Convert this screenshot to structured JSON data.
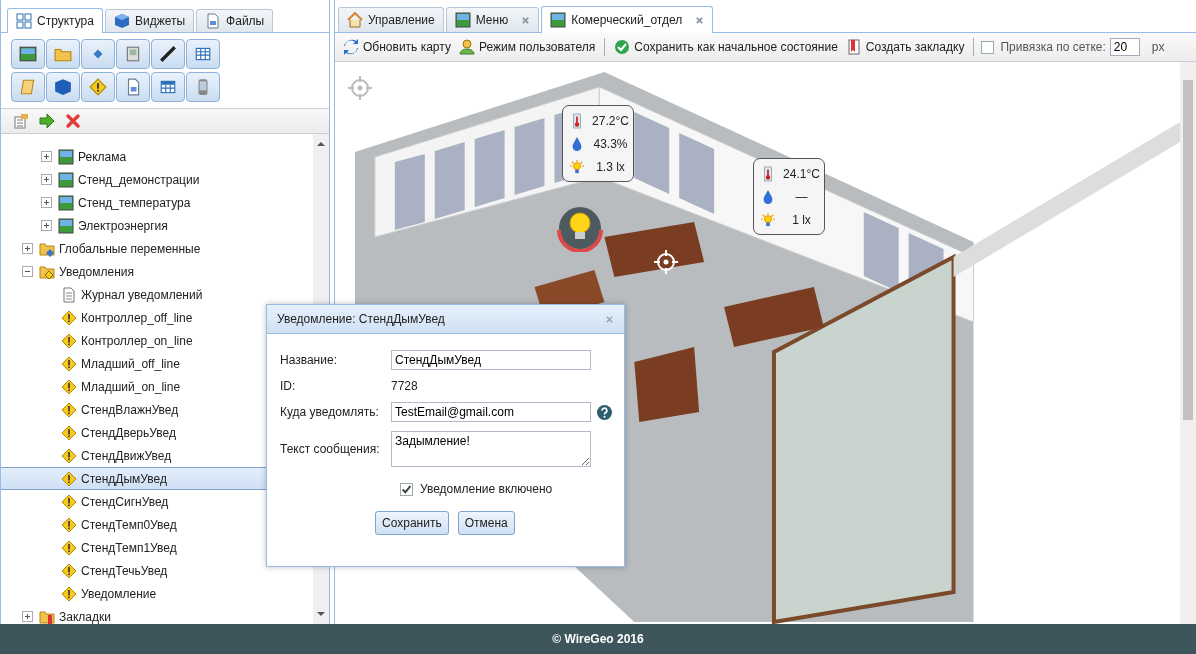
{
  "left_panel": {
    "tabs": [
      {
        "label": "Структура",
        "selected": true
      },
      {
        "label": "Виджеты",
        "selected": false
      },
      {
        "label": "Файлы",
        "selected": false
      }
    ]
  },
  "tree": {
    "scrolled_children": [
      {
        "label": "Реклама",
        "kind": "map",
        "expanded": false
      },
      {
        "label": "Стенд_демонстрации",
        "kind": "map",
        "expanded": false
      },
      {
        "label": "Стенд_температура",
        "kind": "map",
        "expanded": false
      },
      {
        "label": "Электроэнергия",
        "kind": "map",
        "expanded": false
      }
    ],
    "nodes": [
      {
        "label": "Глобальные переменные",
        "kind": "folder-var",
        "expanded": false,
        "selected": false
      },
      {
        "label": "Уведомления",
        "kind": "folder-alert",
        "expanded": true,
        "selected": false,
        "children": [
          {
            "label": "Журнал уведомлений",
            "kind": "log",
            "selected": false
          },
          {
            "label": "Контроллер_off_line",
            "kind": "alert",
            "selected": false
          },
          {
            "label": "Контроллер_on_line",
            "kind": "alert",
            "selected": false
          },
          {
            "label": "Младший_off_line",
            "kind": "alert",
            "selected": false
          },
          {
            "label": "Младший_on_line",
            "kind": "alert",
            "selected": false
          },
          {
            "label": "СтендВлажнУвед",
            "kind": "alert",
            "selected": false
          },
          {
            "label": "СтендДверьУвед",
            "kind": "alert",
            "selected": false
          },
          {
            "label": "СтендДвижУвед",
            "kind": "alert",
            "selected": false
          },
          {
            "label": "СтендДымУвед",
            "kind": "alert",
            "selected": true
          },
          {
            "label": "СтендСигнУвед",
            "kind": "alert",
            "selected": false
          },
          {
            "label": "СтендТемп0Увед",
            "kind": "alert",
            "selected": false
          },
          {
            "label": "СтендТемп1Увед",
            "kind": "alert",
            "selected": false
          },
          {
            "label": "СтендТечьУвед",
            "kind": "alert",
            "selected": false
          },
          {
            "label": "Уведомление",
            "kind": "alert",
            "selected": false
          }
        ]
      },
      {
        "label": "Закладки",
        "kind": "bookmarks",
        "expanded": false,
        "selected": false
      }
    ]
  },
  "editor": {
    "tabs": [
      {
        "label": "Управление",
        "closable": false,
        "selected": false
      },
      {
        "label": "Меню",
        "closable": true,
        "selected": false
      },
      {
        "label": "Комерческий_отдел",
        "closable": true,
        "selected": true
      }
    ],
    "toolbar": [
      {
        "label": "Обновить карту"
      },
      {
        "label": "Режим пользователя"
      },
      {
        "label": "Сохранить как начальное состояние"
      },
      {
        "label": "Создать закладку"
      }
    ],
    "grid_snap": {
      "label": "Привязка по сетке:",
      "checked": false,
      "value": "20",
      "unit": "px"
    }
  },
  "sensors": [
    {
      "rows": [
        {
          "kind": "temperature",
          "value": "27.2°C"
        },
        {
          "kind": "humidity",
          "value": "43.3%"
        },
        {
          "kind": "light",
          "value": "1.3 lx"
        }
      ]
    },
    {
      "rows": [
        {
          "kind": "temperature",
          "value": "24.1°C"
        },
        {
          "kind": "humidity",
          "value": "—"
        },
        {
          "kind": "light",
          "value": "1 lx"
        }
      ]
    }
  ],
  "dialog": {
    "title": "Уведомление: СтендДымУвед",
    "fields": [
      {
        "kind": "input",
        "label": "Название:",
        "value": "СтендДымУвед"
      },
      {
        "kind": "text",
        "label": "ID:",
        "value": "7728"
      },
      {
        "kind": "input",
        "label": "Куда уведомлять:",
        "value": "TestEmail@gmail.com",
        "help": true
      },
      {
        "kind": "textarea",
        "label": "Текст сообщения:",
        "value": "Задымление!"
      }
    ],
    "enabled": {
      "label": "Уведомление включено",
      "checked": true
    },
    "buttons": [
      "Сохранить",
      "Отмена"
    ]
  },
  "footer": "© WireGeo 2016"
}
